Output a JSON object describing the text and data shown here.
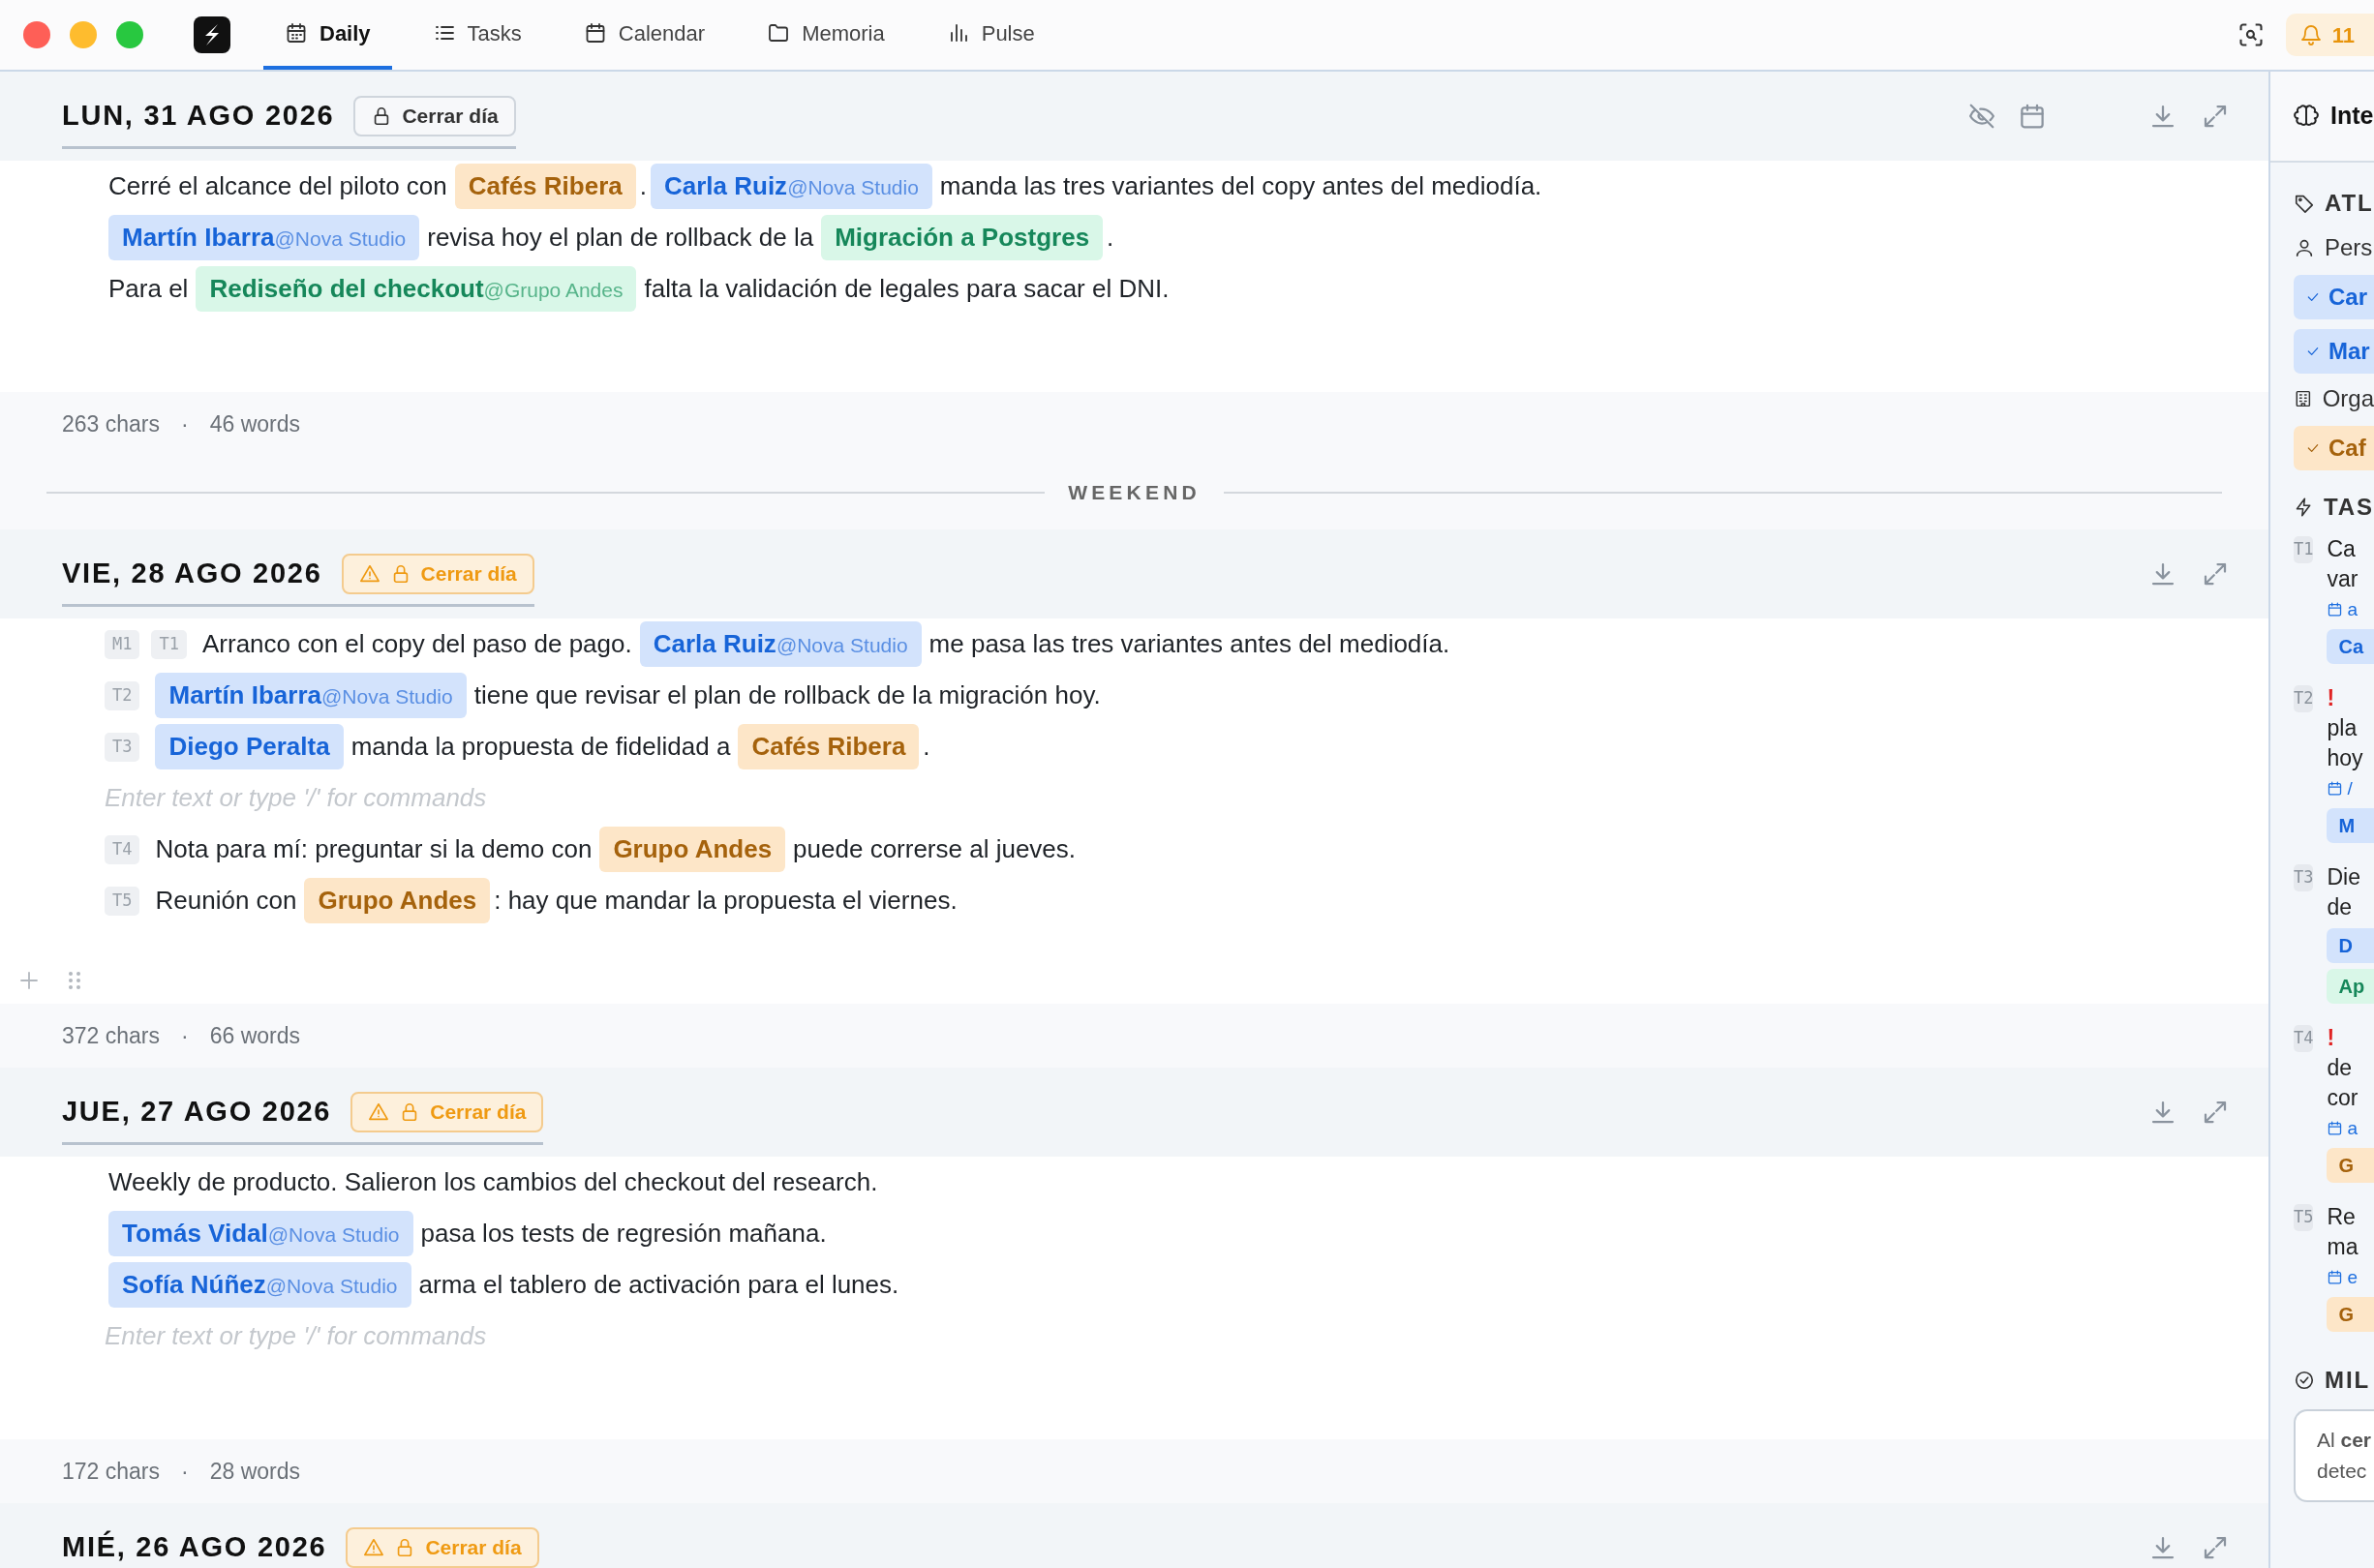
{
  "tabs": [
    {
      "label": "Daily",
      "selected": true
    },
    {
      "label": "Tasks",
      "selected": false
    },
    {
      "label": "Calendar",
      "selected": false
    },
    {
      "label": "Memoria",
      "selected": false
    },
    {
      "label": "Pulse",
      "selected": false
    }
  ],
  "notifications": {
    "count": "11"
  },
  "entries": [
    {
      "kind": "day",
      "date": "LUN, 31 AGO 2026",
      "close_button": {
        "label": "Cerrar día",
        "warning": false
      },
      "planner_tools": true,
      "block_handles": false,
      "lines": [
        {
          "kind": "line",
          "segments": [
            {
              "kind": "text",
              "text": "Cerré el alcance del piloto con"
            },
            {
              "kind": "org",
              "name": "Cafés Ribera"
            },
            {
              "kind": "text",
              "text": "."
            },
            {
              "kind": "person",
              "name": "Carla Ruiz",
              "org": "@Nova Studio"
            },
            {
              "kind": "text",
              "text": "manda las tres variantes del copy antes del mediodía."
            }
          ]
        },
        {
          "kind": "line",
          "segments": [
            {
              "kind": "person",
              "name": "Martín Ibarra",
              "org": "@Nova Studio"
            },
            {
              "kind": "text",
              "text": "revisa hoy el plan de rollback de la"
            },
            {
              "kind": "project",
              "name": "Migración a Postgres"
            },
            {
              "kind": "text",
              "text": "."
            }
          ]
        },
        {
          "kind": "line",
          "segments": [
            {
              "kind": "text",
              "text": "Para el"
            },
            {
              "kind": "project",
              "name": "Rediseño del checkout",
              "org": "@Grupo Andes"
            },
            {
              "kind": "text",
              "text": "falta la validación de legales para sacar el DNI."
            }
          ]
        }
      ],
      "footer": {
        "chars": "263 chars",
        "separator": "·",
        "words": "46 words"
      }
    },
    {
      "kind": "divider",
      "label": "WEEKEND"
    },
    {
      "kind": "day",
      "date": "VIE, 28 AGO 2026",
      "close_button": {
        "label": "Cerrar día",
        "warning": true
      },
      "planner_tools": false,
      "block_handles": true,
      "lines": [
        {
          "kind": "line",
          "badges": [
            "M1",
            "T1"
          ],
          "segments": [
            {
              "kind": "text",
              "text": "Arranco con el copy del paso de pago."
            },
            {
              "kind": "person",
              "name": "Carla Ruiz",
              "org": "@Nova Studio"
            },
            {
              "kind": "text",
              "text": "me pasa las tres variantes antes del mediodía."
            }
          ]
        },
        {
          "kind": "line",
          "badges": [
            "T2"
          ],
          "segments": [
            {
              "kind": "person",
              "name": "Martín Ibarra",
              "org": "@Nova Studio"
            },
            {
              "kind": "text",
              "text": "tiene que revisar el plan de rollback de la migración hoy."
            }
          ]
        },
        {
          "kind": "line",
          "badges": [
            "T3"
          ],
          "segments": [
            {
              "kind": "person",
              "name": "Diego Peralta"
            },
            {
              "kind": "text",
              "text": "manda la propuesta de fidelidad a"
            },
            {
              "kind": "org",
              "name": "Cafés Ribera"
            },
            {
              "kind": "text",
              "text": "."
            }
          ]
        },
        {
          "kind": "placeholder",
          "text": "Enter text or type '/' for commands"
        },
        {
          "kind": "line",
          "badges": [
            "T4"
          ],
          "segments": [
            {
              "kind": "text",
              "text": "Nota para mí: preguntar si la demo con"
            },
            {
              "kind": "org",
              "name": "Grupo Andes"
            },
            {
              "kind": "text",
              "text": "puede correrse al jueves."
            }
          ]
        },
        {
          "kind": "line",
          "badges": [
            "T5"
          ],
          "segments": [
            {
              "kind": "text",
              "text": "Reunión con"
            },
            {
              "kind": "org",
              "name": "Grupo Andes"
            },
            {
              "kind": "text",
              "text": ": hay que mandar la propuesta el viernes."
            }
          ]
        }
      ],
      "footer": {
        "chars": "372 chars",
        "separator": "·",
        "words": "66 words"
      }
    },
    {
      "kind": "day",
      "date": "JUE, 27 AGO 2026",
      "close_button": {
        "label": "Cerrar día",
        "warning": true
      },
      "planner_tools": false,
      "block_handles": false,
      "lines": [
        {
          "kind": "line",
          "segments": [
            {
              "kind": "text",
              "text": "Weekly de producto. Salieron los cambios del checkout del research."
            }
          ]
        },
        {
          "kind": "line",
          "segments": [
            {
              "kind": "person",
              "name": "Tomás Vidal",
              "org": "@Nova Studio"
            },
            {
              "kind": "text",
              "text": "pasa los tests de regresión mañana."
            }
          ]
        },
        {
          "kind": "line",
          "segments": [
            {
              "kind": "person",
              "name": "Sofía Núñez",
              "org": "@Nova Studio"
            },
            {
              "kind": "text",
              "text": "arma el tablero de activación para el lunes."
            }
          ]
        },
        {
          "kind": "placeholder",
          "text": "Enter text or type '/' for commands"
        }
      ],
      "footer": {
        "chars": "172 chars",
        "separator": "·",
        "words": "28 words"
      }
    },
    {
      "kind": "day",
      "date": "MIÉ, 26 AGO 2026",
      "close_button": {
        "label": "Cerrar día",
        "warning": true
      },
      "planner_tools": false
    }
  ],
  "sidebar": {
    "title": "Inte",
    "items": [
      {
        "kind": "heading",
        "text": "ATL"
      },
      {
        "kind": "subheading",
        "text": "Pers"
      },
      {
        "kind": "person",
        "text": "Car",
        "checked": true
      },
      {
        "kind": "person",
        "text": "Mar",
        "checked": true
      },
      {
        "kind": "subheading",
        "text": "Orga"
      },
      {
        "kind": "org",
        "text": "Caf",
        "checked": true
      },
      {
        "kind": "heading",
        "text": "TAS"
      },
      {
        "kind": "task",
        "id": "T1",
        "lines": [
          "Ca",
          "var"
        ],
        "due": "a",
        "chips": [
          {
            "kind": "person",
            "text": "Ca"
          }
        ]
      },
      {
        "kind": "task",
        "id": "T2",
        "priority": "!",
        "lines": [
          "pla",
          "hoy"
        ],
        "due": "/",
        "chips": [
          {
            "kind": "person",
            "text": "M"
          }
        ]
      },
      {
        "kind": "task",
        "id": "T3",
        "lines": [
          "Die",
          "de"
        ],
        "chips": [
          {
            "kind": "person",
            "text": "D"
          },
          {
            "kind": "project",
            "text": "Ap"
          }
        ]
      },
      {
        "kind": "task",
        "id": "T4",
        "priority": "!",
        "lines": [
          "de",
          "cor"
        ],
        "due": "a",
        "chips": [
          {
            "kind": "org",
            "text": "G"
          }
        ]
      },
      {
        "kind": "task",
        "id": "T5",
        "lines": [
          "Re",
          "ma"
        ],
        "due": "e",
        "chips": [
          {
            "kind": "org",
            "text": "G"
          }
        ]
      },
      {
        "kind": "heading",
        "text": "MIL"
      },
      {
        "kind": "card",
        "lines": [
          "Al **cer**",
          "detec"
        ]
      }
    ]
  }
}
